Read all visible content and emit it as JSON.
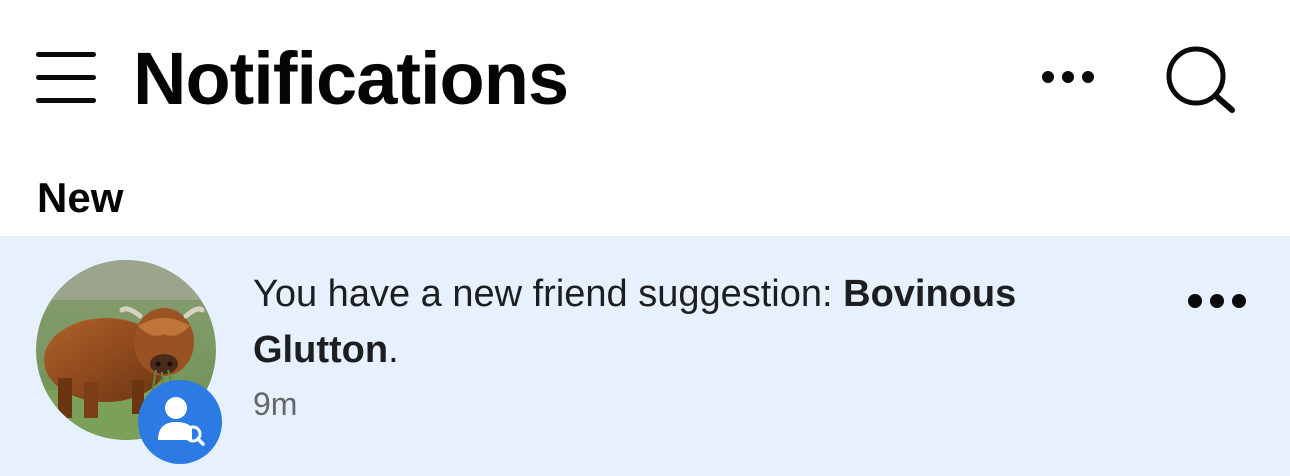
{
  "header": {
    "title": "Notifications",
    "menu_icon": "hamburger-menu-icon",
    "more_icon": "more-horizontal-icon",
    "search_icon": "search-icon"
  },
  "sections": [
    {
      "label": "New",
      "items": [
        {
          "text_prefix": "You have a new friend suggestion: ",
          "name_first": "Bovinous",
          "name_second": "Glutton",
          "text_suffix": ".",
          "time": "9m",
          "badge_icon": "friend-suggestion-icon",
          "avatar": "highland-cow-photo",
          "unread_background": "#e7f1fd",
          "badge_color": "#2c7be5"
        }
      ]
    }
  ]
}
